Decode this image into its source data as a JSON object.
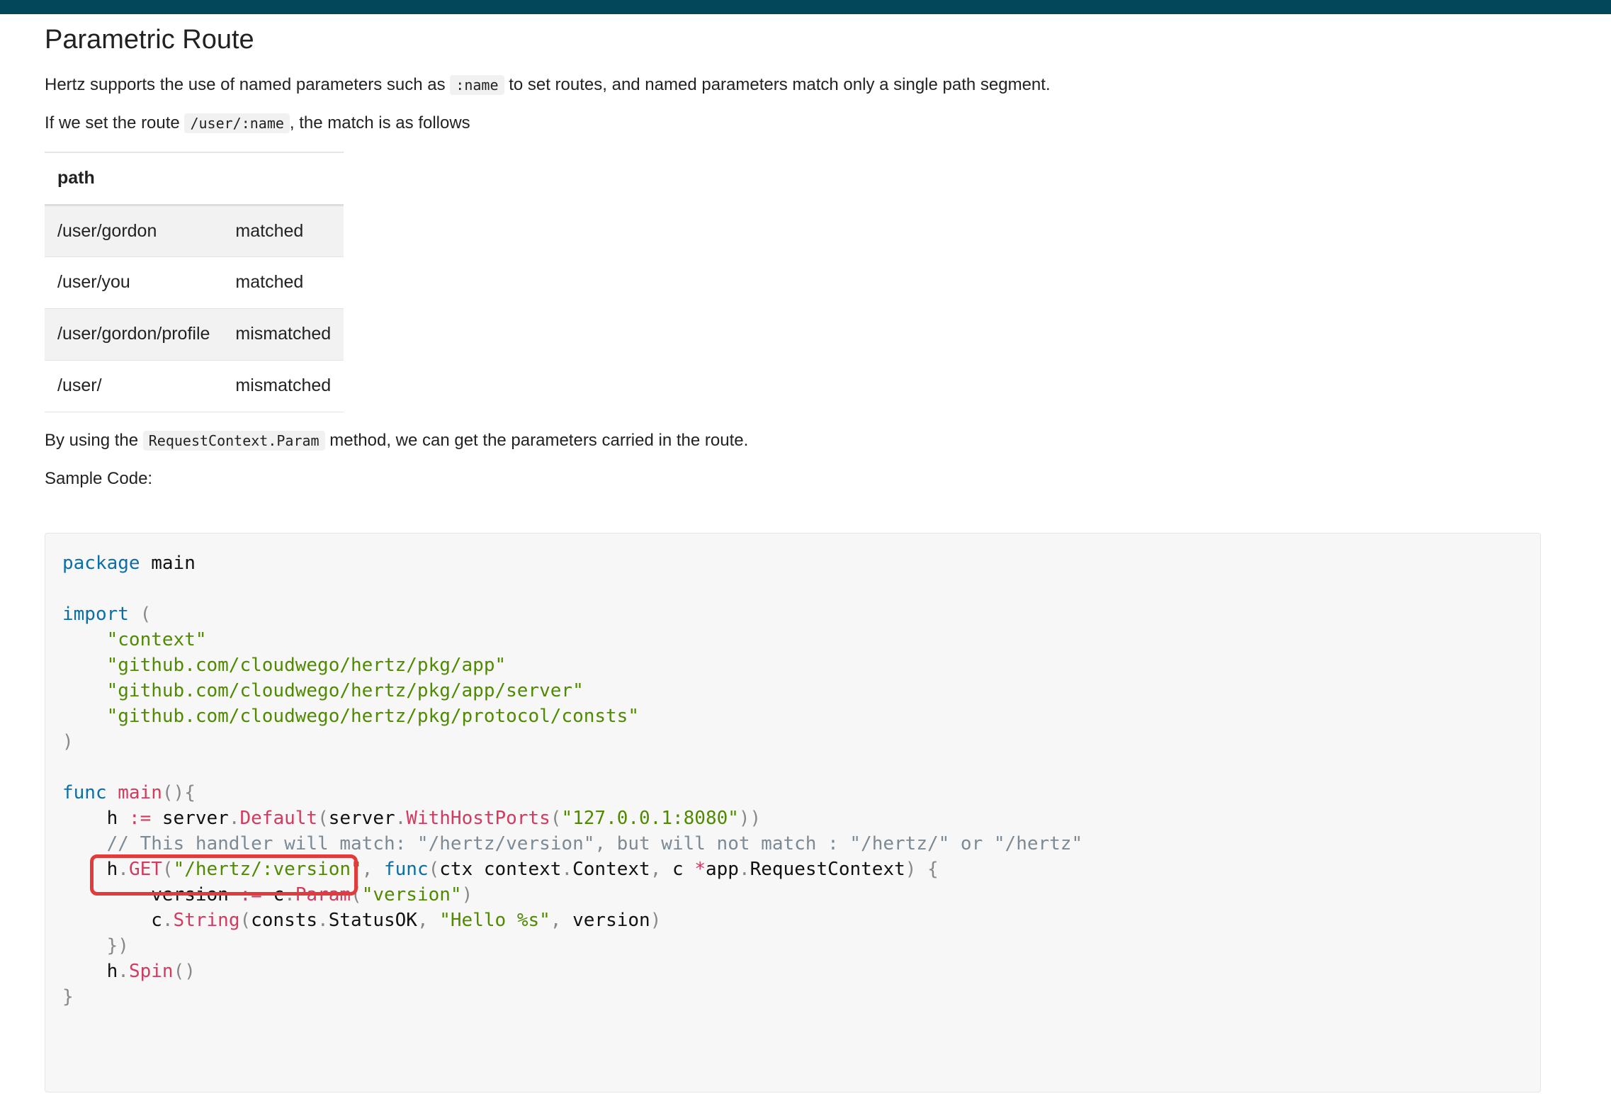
{
  "page": {
    "title": "Parametric Route",
    "intro_1a": "Hertz supports the use of named parameters such as",
    "intro_1_code": ":name",
    "intro_1b": "to set routes, and named parameters match only a single path segment.",
    "intro_2a": "If we set the route",
    "intro_2_code": "/user/:name",
    "intro_2b": ", the match is as follows",
    "after_table_a": "By using the",
    "after_table_code": "RequestContext.Param",
    "after_table_b": "method, we can get the parameters carried in the route.",
    "sample_label": "Sample Code:"
  },
  "table": {
    "header": "path",
    "rows": [
      {
        "path": "/user/gordon",
        "result": "matched"
      },
      {
        "path": "/user/you",
        "result": "matched"
      },
      {
        "path": "/user/gordon/profile",
        "result": "mismatched"
      },
      {
        "path": "/user/",
        "result": "mismatched"
      }
    ]
  },
  "code": {
    "pkg_kw": "package",
    "pkg_name": "main",
    "import_kw": "import",
    "import_open": "(",
    "imports": [
      "\"context\"",
      "\"github.com/cloudwego/hertz/pkg/app\"",
      "\"github.com/cloudwego/hertz/pkg/app/server\"",
      "\"github.com/cloudwego/hertz/pkg/protocol/consts\""
    ],
    "import_close": ")",
    "func_kw": "func",
    "main_name": "main",
    "main_paren": "(){",
    "l_h": "h",
    "l_assign": ":=",
    "l_server": "server",
    "l_dot": ".",
    "l_default": "Default",
    "l_open": "(",
    "l_with": "WithHostPorts",
    "l_host": "\"127.0.0.1:8080\"",
    "l_close2": "))",
    "comment": "// This handler will match: \"/hertz/version\", but will not match : \"/hertz/\" or \"/hertz\"",
    "get_name": "GET",
    "get_route": "\"/hertz/:version\"",
    "comma": ",",
    "ctx_params_a": "ctx context",
    "ctx_type": "Context",
    "c_param": "c",
    "star": "*",
    "app_pkg": "app",
    "req_ctx": "RequestContext",
    "brace_open": ") {",
    "version_var": "version",
    "c_var": "c",
    "param_fn": "Param",
    "param_arg": "\"version\"",
    "close_paren": ")",
    "string_fn": "String",
    "consts_pkg": "consts",
    "status_ok": "StatusOK",
    "hello_fmt": "\"Hello %s\"",
    "close_func": "})",
    "spin_fn": "Spin",
    "spin_paren": "()",
    "final_brace": "}"
  },
  "colors": {
    "topbar": "#03475b",
    "keyword": "#0a6ea8",
    "string": "#4f8a00",
    "function": "#d33a5e",
    "highlight_border": "#e23b3b"
  }
}
